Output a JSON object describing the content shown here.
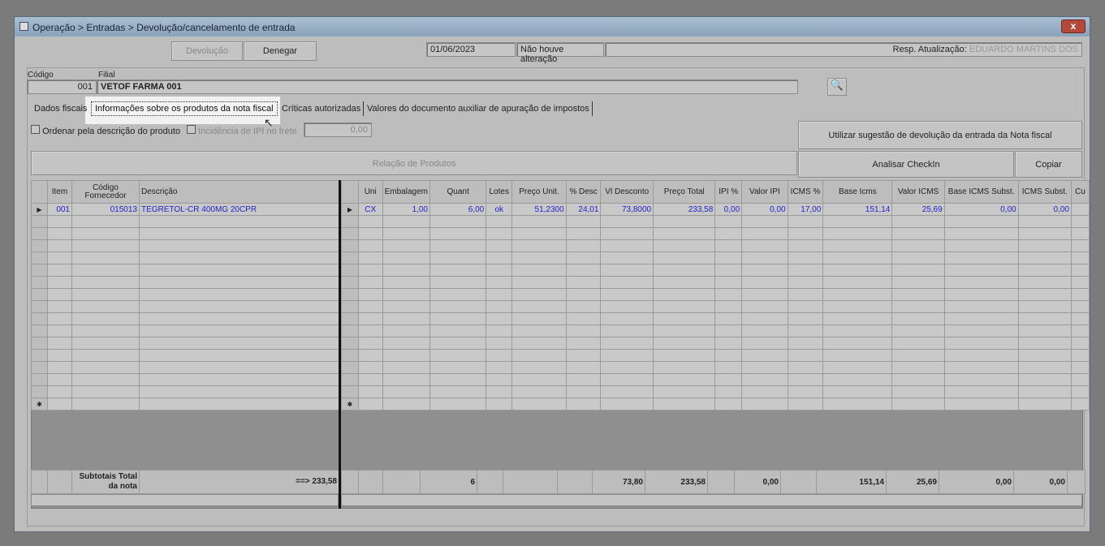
{
  "window": {
    "title": "Operação > Entradas > Devolução/cancelamento de entrada",
    "close": "x"
  },
  "toolbar": {
    "devolucao": "Devolução",
    "denegar": "Denegar",
    "date": "01/06/2023",
    "status": "Não houve alteração",
    "resp_label": "Resp. Atualização:",
    "resp_value": "EDUARDO MARTINS DOS"
  },
  "filial": {
    "codigo_label": "Código",
    "codigo_value": "001",
    "filial_label": "Filial",
    "filial_value": "VETOF FARMA 001"
  },
  "tabs": [
    "Dados fiscais",
    "Informações sobre os produtos da nota fiscal",
    "Críticas autorizadas",
    "Valores do documento auxiliar de apuração de impostos"
  ],
  "options": {
    "ordenar": "Ordenar pela descrição do produto",
    "incidencia": "Incidência de IPI no frete",
    "frete_value": "0,00"
  },
  "buttons": {
    "sugestao": "Utilizar sugestão de devolução da entrada da Nota fiscal",
    "relacao": "Relação de Produtos",
    "checkin": "Analisar CheckIn",
    "copiar": "Copiar"
  },
  "grid_left": {
    "columns": [
      "",
      "Item",
      "Código Fornecedor",
      "Descrição"
    ],
    "row": [
      "▶",
      "001",
      "015013",
      "TEGRETOL-CR 400MG 20CPR"
    ],
    "totals": [
      "",
      "",
      "Subtotais Total da nota",
      "==> 233,58"
    ]
  },
  "grid_right": {
    "columns": [
      "",
      "Uni",
      "Embalagem",
      "Quant",
      "Lotes",
      "Preço Unit.",
      "% Desc",
      "Vl Desconto",
      "Preço Total",
      "IPI %",
      "Valor IPI",
      "ICMS %",
      "Base Icms",
      "Valor ICMS",
      "Base ICMS Subst.",
      "ICMS Subst.",
      "Cu"
    ],
    "row": [
      "▶",
      "CX",
      "1,00",
      "6,00",
      "ok",
      "51,2300",
      "24,01",
      "73,8000",
      "233,58",
      "0,00",
      "0,00",
      "17,00",
      "151,14",
      "25,69",
      "0,00",
      "0,00",
      ""
    ],
    "totals": [
      "",
      "",
      "",
      "6",
      "",
      "",
      "",
      "73,80",
      "233,58",
      "",
      "0,00",
      "",
      "151,14",
      "25,69",
      "0,00",
      "0,00",
      ""
    ]
  },
  "new_row_marker": "✱"
}
